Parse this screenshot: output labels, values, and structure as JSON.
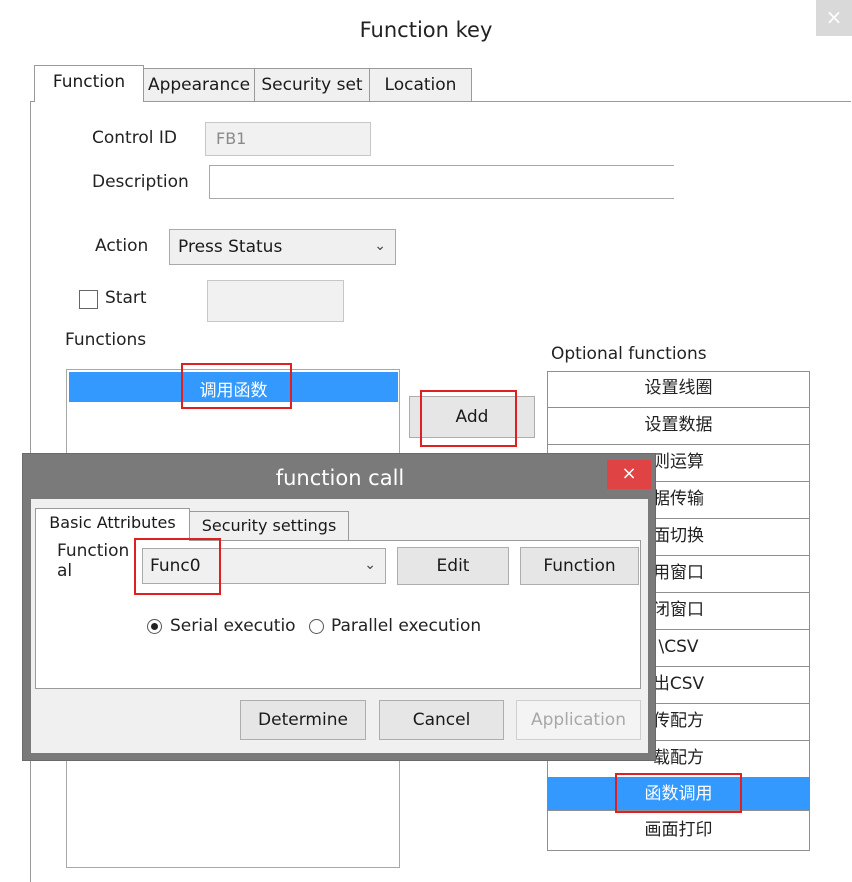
{
  "outer_dialog": {
    "title": "Function key",
    "close_glyph": "×",
    "tabs": [
      "Function",
      "Appearance",
      "Security set",
      "Location"
    ],
    "active_tab": "Function",
    "control_id": {
      "label": "Control ID",
      "value": "FB1"
    },
    "description": {
      "label": "Description",
      "value": ""
    },
    "action": {
      "label": "Action",
      "value": "Press Status"
    },
    "start": {
      "label": "Start",
      "checked": false,
      "value": ""
    },
    "functions": {
      "label": "Functions",
      "items": [
        "调用函数"
      ],
      "selected_index": 0
    },
    "add_button": "Add",
    "optional_functions": {
      "label": "Optional functions",
      "items": [
        "设置线圈",
        "设置数据",
        "四则运算",
        "数据传输",
        "画面切换",
        "打开窗口",
        "关闭窗口",
        "导入CSV",
        "导出CSV",
        "上传配方",
        "下载配方",
        "函数调用",
        "画面打印"
      ],
      "visible_text": [
        "设置线圈",
        "设置数据",
        "则运算",
        "据传输",
        "面切换",
        "用窗口",
        "闭窗口",
        "\\CSV",
        "出CSV",
        "传配方",
        "载配方",
        "函数调用",
        "画面打印"
      ],
      "selected": "函数调用"
    }
  },
  "inner_dialog": {
    "title": "function call",
    "close_glyph": "×",
    "tabs": [
      "Basic Attributes",
      "Security settings"
    ],
    "active_tab": "Basic Attributes",
    "functional_label_line1": "Function",
    "functional_label_line2": "al",
    "function_value": "Func0",
    "edit_button": "Edit",
    "function_button": "Function",
    "execution": {
      "options": [
        "Serial executio",
        "Parallel execution"
      ],
      "selected": "Serial execution"
    },
    "buttons": {
      "determine": "Determine",
      "cancel": "Cancel",
      "application": "Application"
    }
  },
  "icons": {
    "chevron": "chevron-down-icon",
    "check": "checkbox-icon"
  },
  "colors": {
    "selection": "#3399ff",
    "highlight_box": "#e02020",
    "inner_close": "#e04343"
  }
}
